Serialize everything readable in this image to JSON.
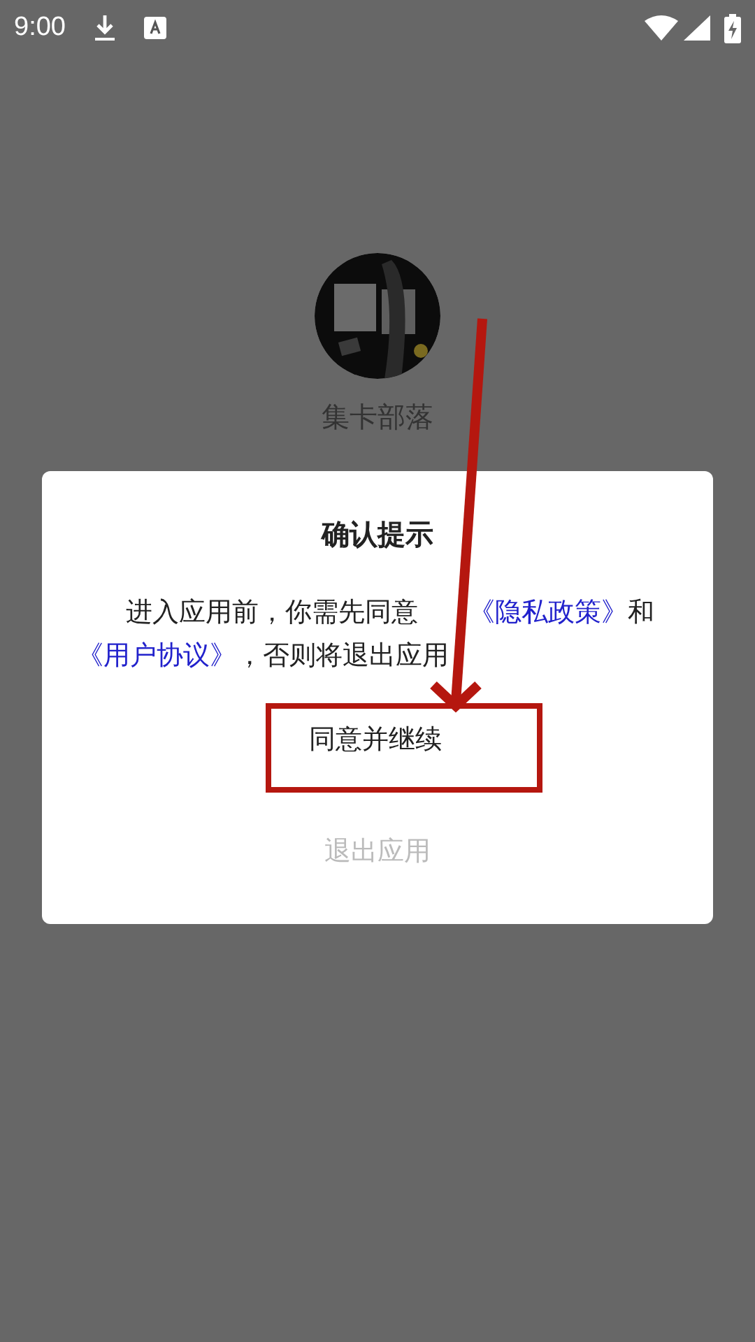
{
  "status_bar": {
    "time": "9:00"
  },
  "app": {
    "name": "集卡部落"
  },
  "dialog": {
    "title": "确认提示",
    "message": [
      {
        "kind": "text",
        "text": "进入应用前，你需先同意"
      },
      {
        "kind": "link",
        "text": "《隐私政策》"
      },
      {
        "kind": "text",
        "text": "和"
      },
      {
        "kind": "link",
        "text": "《用户协议》"
      },
      {
        "kind": "text",
        "text": "，否则将退出应用"
      }
    ],
    "buttons": [
      {
        "label": "同意并继续",
        "kind": "primary",
        "highlighted": true
      },
      {
        "label": "退出应用",
        "kind": "secondary",
        "highlighted": false
      }
    ]
  },
  "annotations": [
    {
      "kind": "arrow"
    }
  ]
}
